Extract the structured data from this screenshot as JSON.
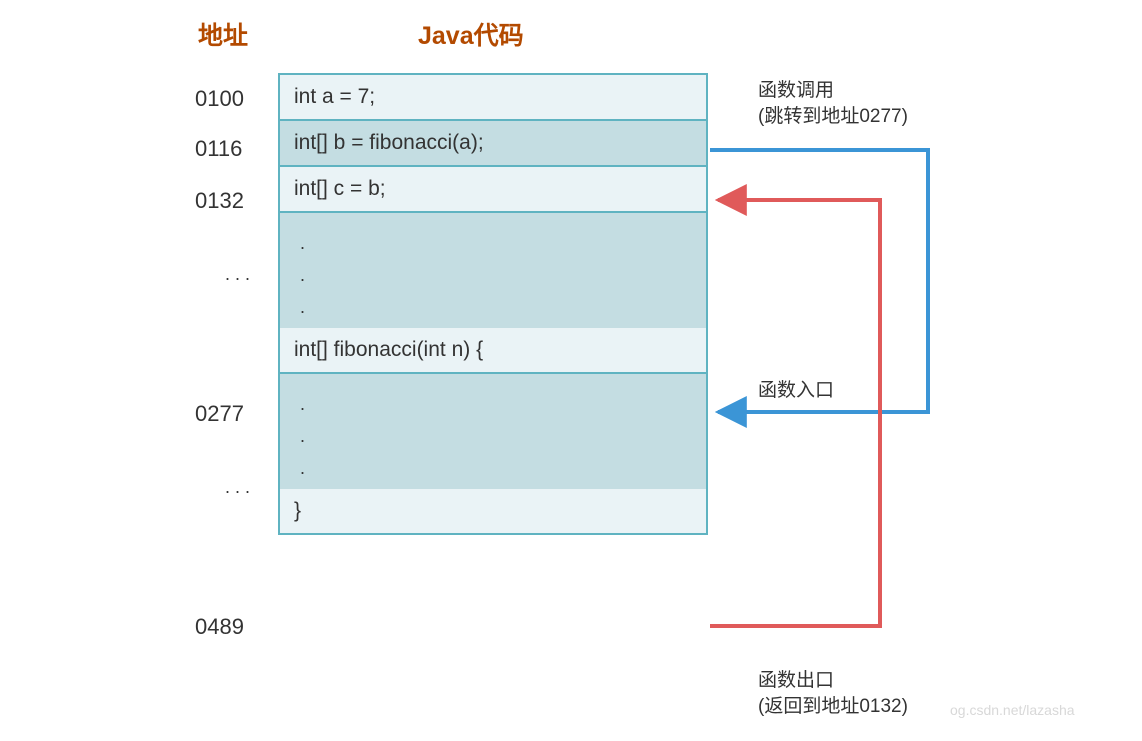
{
  "header": {
    "addr": "地址",
    "code": "Java代码"
  },
  "rows": {
    "r0": "int a = 7;",
    "r1": "int[] b = fibonacci(a);",
    "r2": "int[] c = b;",
    "r3dots": ".\n.\n.",
    "r4": "int[] fibonacci(int n) {",
    "r5dots": ".\n.\n.",
    "r6": "}"
  },
  "addrs": {
    "a0": "0100",
    "a1": "0116",
    "a2": "0132",
    "a4": "0277",
    "a6": "0489"
  },
  "addr_dots": ".\n.\n.",
  "ann": {
    "call": "函数调用\n(跳转到地址0277)",
    "entry": "函数入口",
    "exit": "函数出口\n(返回到地址0132)"
  },
  "watermark": "og.csdn.net/lazasha"
}
